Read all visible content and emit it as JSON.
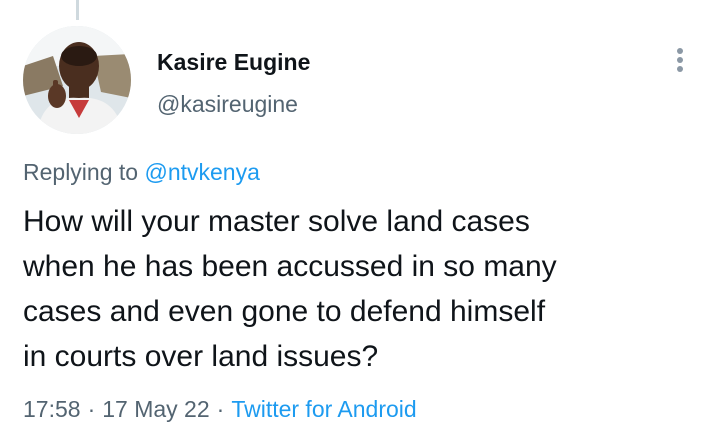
{
  "author": {
    "display_name": "Kasire Eugine",
    "handle": "@kasireugine",
    "avatar": "profile-photo"
  },
  "menu": {
    "icon": "more-vertical-icon"
  },
  "reply": {
    "prefix": "Replying to",
    "mention": "@ntvkenya"
  },
  "tweet": {
    "text_lines": [
      "How will your master solve land cases",
      "when he has been accussed in so many",
      "cases and even gone to defend himself",
      "in courts over land issues?"
    ]
  },
  "meta": {
    "time": "17:58",
    "separator": "·",
    "date": "17 May 22",
    "source": "Twitter for Android"
  },
  "colors": {
    "link": "#1d9bf0",
    "secondary_text": "#536471",
    "primary_text": "#0f1419"
  }
}
